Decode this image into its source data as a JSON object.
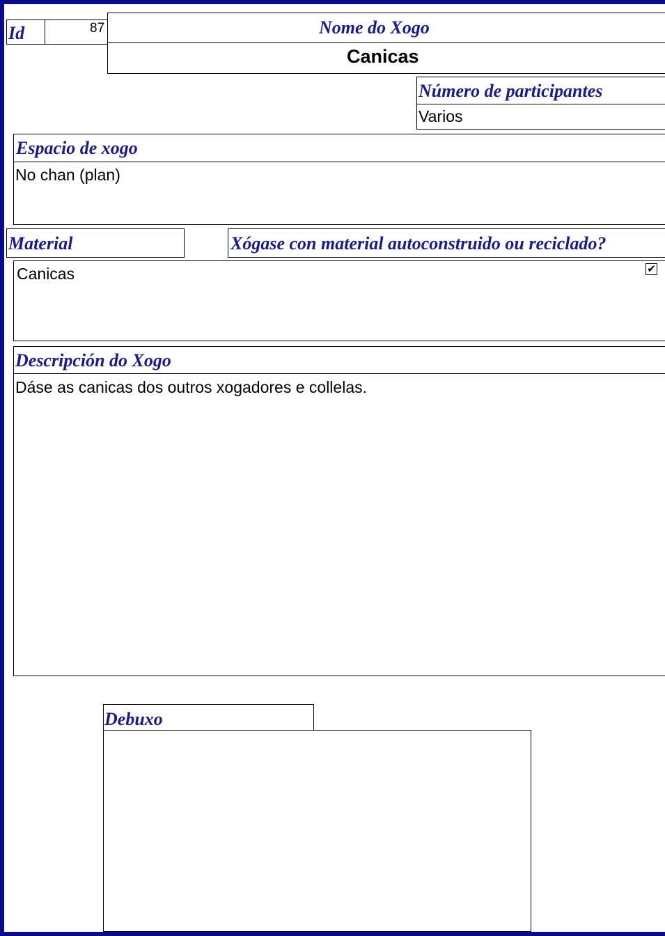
{
  "id": {
    "label": "Id",
    "value": "87"
  },
  "game_name": {
    "label": "Nome do Xogo",
    "value": "Canicas"
  },
  "participants": {
    "label": "Número de participantes",
    "value": "Varios"
  },
  "play_space": {
    "label": "Espacio de xogo",
    "value": "No chan (plan)"
  },
  "material": {
    "label": "Material",
    "value": "Canicas"
  },
  "recycled": {
    "label": "Xógase con material autoconstruido ou reciclado?",
    "checked": true,
    "check_glyph": "✔"
  },
  "description": {
    "label": "Descripción do Xogo",
    "value": "Dáse as canicas dos outros xogadores e collelas."
  },
  "drawing": {
    "label": "Debuxo"
  },
  "colors": {
    "label": "#1a1a8c",
    "frame": "#0a0a8c"
  }
}
